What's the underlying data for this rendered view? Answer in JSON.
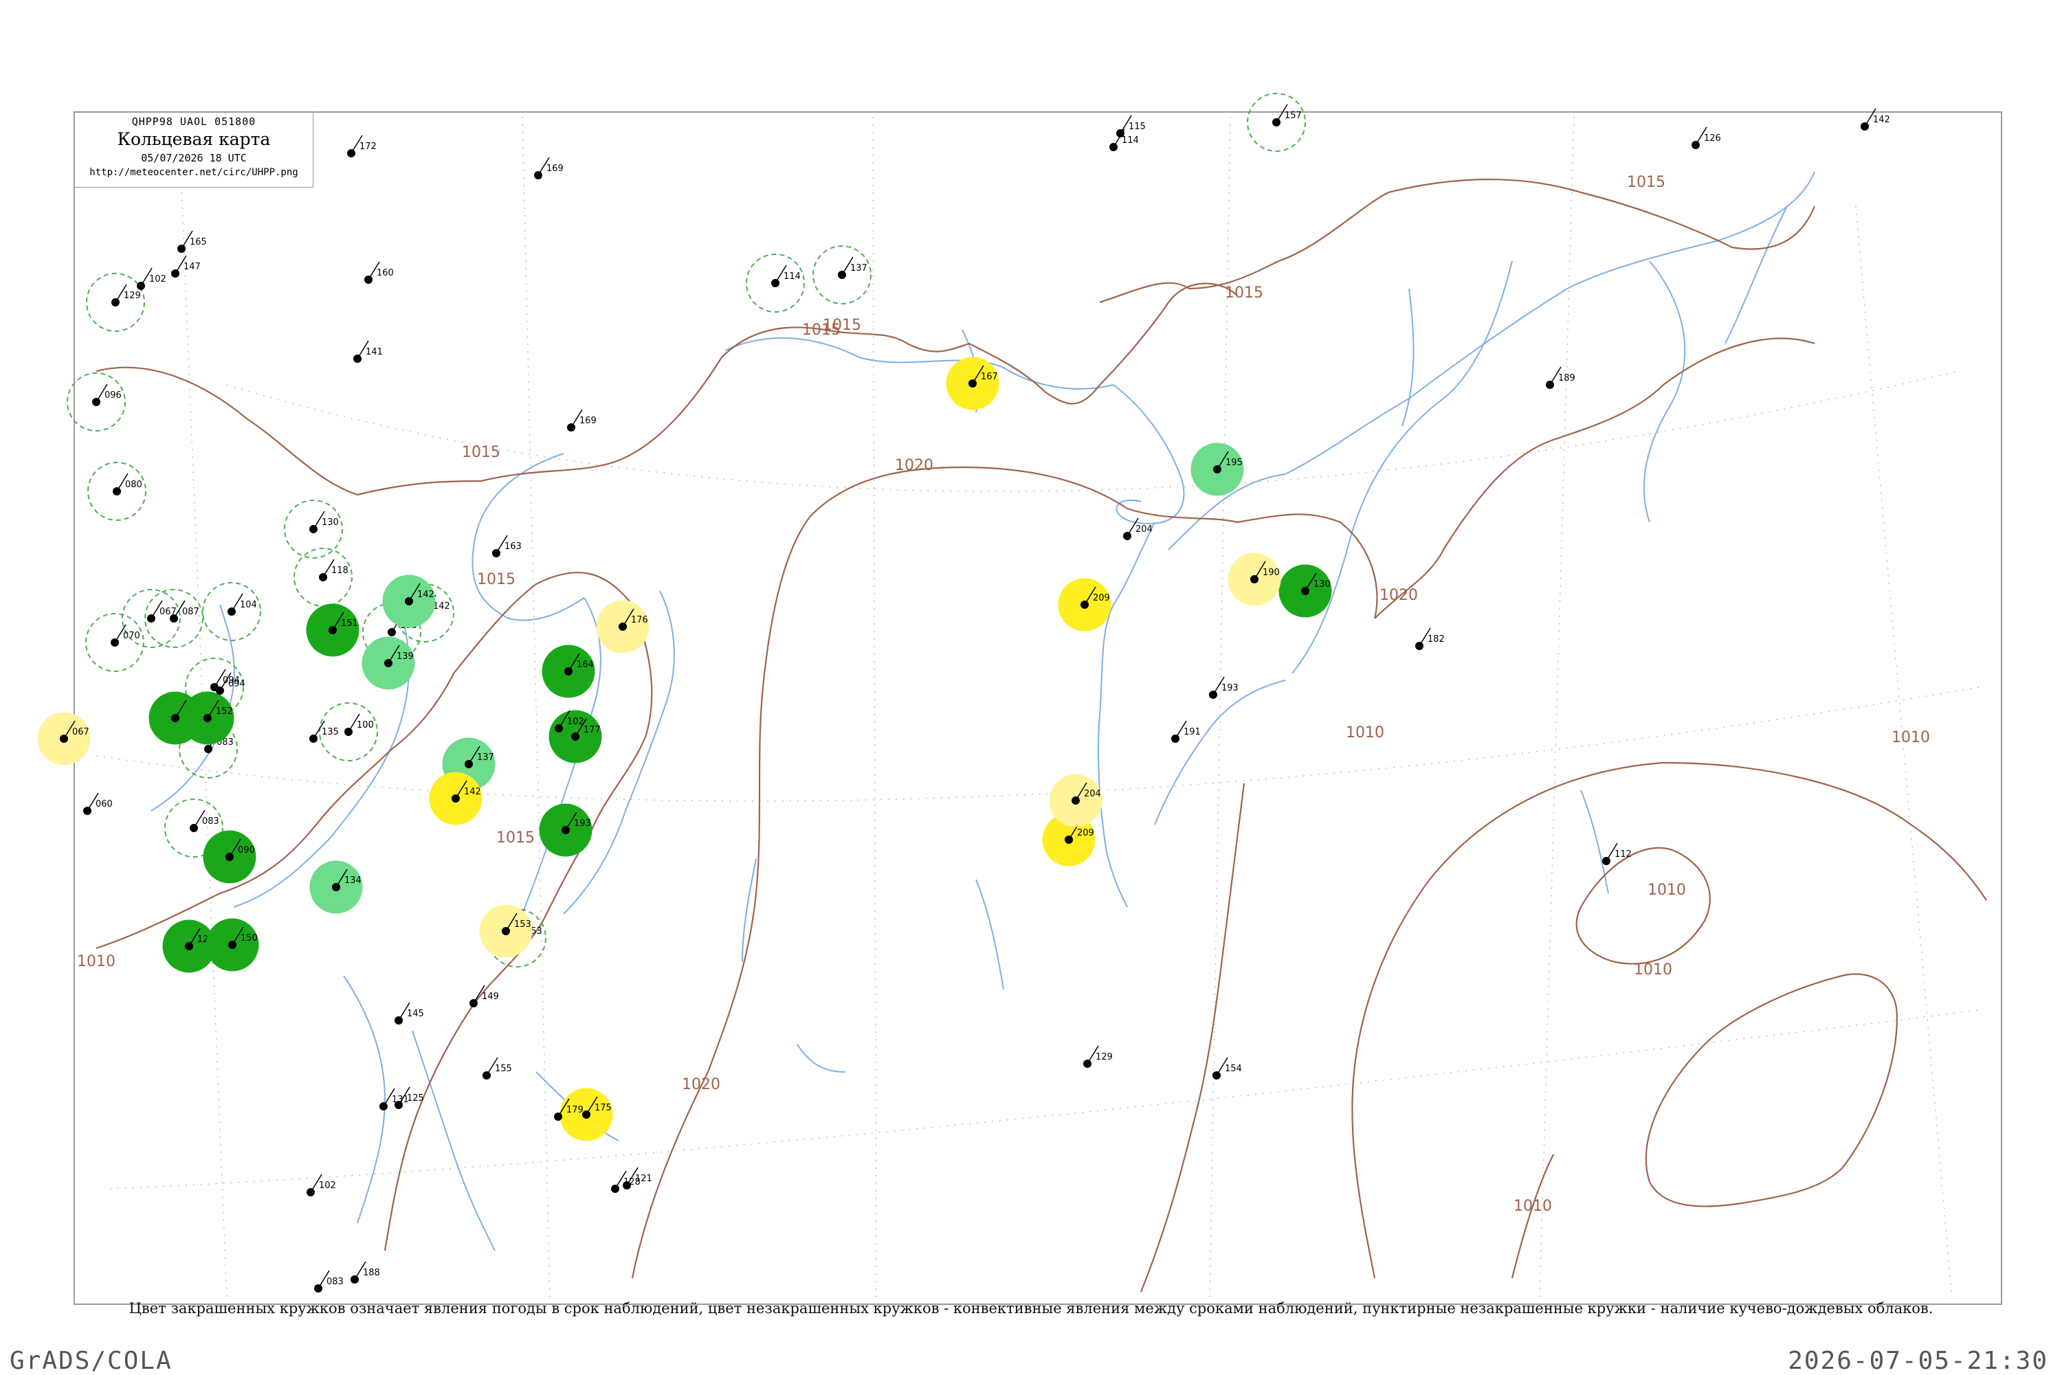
{
  "header": {
    "code": "QHPP98  UAOL  051800",
    "title": "Кольцевая карта",
    "datetime": "05/07/2026 18 UTC",
    "url": "http://meteocenter.net/circ/UHPP.png"
  },
  "caption": "Цвет закрашенных кружков означает явления погоды в срок наблюдений, цвет незакрашенных кружков - конвективные явления между сроками наблюдений, пунктирные незакрашенные кружки - наличие кучево-дождевых облаков.",
  "footer": {
    "left": "GrADS/COLA",
    "right": "2026-07-05-21:30"
  },
  "isobar_labels": [
    "1015",
    "1015",
    "1015",
    "1015",
    "1015",
    "1015",
    "1020",
    "1020",
    "1020",
    "1010",
    "1010",
    "1010",
    "1010",
    "1010",
    "1015",
    "1010"
  ],
  "stations": [
    {
      "p": "ring",
      "c": "#4caf50",
      "num": "129"
    },
    {
      "p": "ring",
      "c": "#4caf50",
      "num": "096"
    },
    {
      "p": "ring",
      "c": "#4caf50",
      "num": "080"
    },
    {
      "p": "ring",
      "c": "#4caf50",
      "num": "130"
    },
    {
      "p": "ring",
      "c": "#4caf50",
      "num": "118"
    },
    {
      "p": "ring",
      "c": "#4caf50",
      "num": "067"
    },
    {
      "p": "ring",
      "c": "#4caf50",
      "num": "070"
    },
    {
      "p": "ring",
      "c": "#4caf50",
      "num": "087"
    },
    {
      "p": "ring",
      "c": "#4caf50",
      "num": "104"
    },
    {
      "p": "ring",
      "c": "#4caf50",
      "num": "094"
    },
    {
      "p": "ring",
      "c": "#4caf50",
      "num": "083"
    },
    {
      "p": "ring",
      "c": "#4caf50",
      "num": "083"
    },
    {
      "p": "ring",
      "c": "#4caf50",
      "num": "100"
    },
    {
      "p": "ring",
      "c": "#4caf50",
      "num": "138"
    },
    {
      "p": "ring",
      "c": "#4caf50",
      "num": "142"
    },
    {
      "p": "ring",
      "c": "#4caf50",
      "num": "114"
    },
    {
      "p": "ring",
      "c": "#4caf50",
      "num": "137"
    },
    {
      "p": "ring",
      "c": "#4caf50",
      "num": "157"
    },
    {
      "p": "ring",
      "c": "#4caf50",
      "num": "153"
    },
    {
      "p": "fill",
      "c": "#1aa81a",
      "num": "140"
    },
    {
      "p": "fill",
      "c": "#1aa81a",
      "num": "152"
    },
    {
      "p": "fill",
      "c": "#1aa81a",
      "num": "090"
    },
    {
      "p": "fill",
      "c": "#1aa81a",
      "num": "128"
    },
    {
      "p": "fill",
      "c": "#1aa81a",
      "num": "150"
    },
    {
      "p": "fill",
      "c": "#1aa81a",
      "num": "151"
    },
    {
      "p": "fill",
      "c": "#1aa81a",
      "num": "164"
    },
    {
      "p": "fill",
      "c": "#1aa81a",
      "num": "177"
    },
    {
      "p": "fill",
      "c": "#1aa81a",
      "num": "193"
    },
    {
      "p": "fill",
      "c": "#1aa81a",
      "num": "130"
    },
    {
      "p": "fill",
      "c": "#6ddc8b",
      "num": "142"
    },
    {
      "p": "fill",
      "c": "#6ddc8b",
      "num": "139"
    },
    {
      "p": "fill",
      "c": "#6ddc8b",
      "num": "137"
    },
    {
      "p": "fill",
      "c": "#6ddc8b",
      "num": "134"
    },
    {
      "p": "fill",
      "c": "#6ddc8b",
      "num": "195"
    },
    {
      "p": "fill",
      "c": "#ffee22",
      "num": "167"
    },
    {
      "p": "fill",
      "c": "#ffee22",
      "num": "209"
    },
    {
      "p": "fill",
      "c": "#ffee22",
      "num": "142"
    },
    {
      "p": "fill",
      "c": "#ffee22",
      "num": "209"
    },
    {
      "p": "fill",
      "c": "#ffee22",
      "num": "175"
    },
    {
      "p": "fill",
      "c": "#fff49a",
      "num": "176"
    },
    {
      "p": "fill",
      "c": "#fff49a",
      "num": "190"
    },
    {
      "p": "fill",
      "c": "#fff49a",
      "num": "204"
    },
    {
      "p": "fill",
      "c": "#fff49a",
      "num": "067"
    },
    {
      "p": "fill",
      "c": "#fff49a",
      "num": "153"
    },
    {
      "p": "plain",
      "c": "#000000",
      "num": "142"
    },
    {
      "p": "plain",
      "c": "#000000",
      "num": "126"
    },
    {
      "p": "plain",
      "c": "#000000",
      "num": "112"
    },
    {
      "p": "plain",
      "c": "#000000",
      "num": "115"
    },
    {
      "p": "plain",
      "c": "#000000",
      "num": "114"
    },
    {
      "p": "plain",
      "c": "#000000",
      "num": "169"
    },
    {
      "p": "plain",
      "c": "#000000",
      "num": "163"
    },
    {
      "p": "plain",
      "c": "#000000",
      "num": "204"
    },
    {
      "p": "plain",
      "c": "#000000",
      "num": "193"
    },
    {
      "p": "plain",
      "c": "#000000",
      "num": "191"
    },
    {
      "p": "plain",
      "c": "#000000",
      "num": "182"
    },
    {
      "p": "plain",
      "c": "#000000",
      "num": "189"
    },
    {
      "p": "plain",
      "c": "#000000",
      "num": "172"
    },
    {
      "p": "plain",
      "c": "#000000",
      "num": "160"
    },
    {
      "p": "plain",
      "c": "#000000",
      "num": "141"
    },
    {
      "p": "plain",
      "c": "#000000",
      "num": "165"
    },
    {
      "p": "plain",
      "c": "#000000",
      "num": "135"
    },
    {
      "p": "plain",
      "c": "#000000",
      "num": "147"
    },
    {
      "p": "plain",
      "c": "#000000",
      "num": "102"
    },
    {
      "p": "plain",
      "c": "#000000",
      "num": "169"
    },
    {
      "p": "plain",
      "c": "#000000",
      "num": "129"
    },
    {
      "p": "plain",
      "c": "#000000",
      "num": "145"
    },
    {
      "p": "plain",
      "c": "#000000",
      "num": "149"
    },
    {
      "p": "plain",
      "c": "#000000",
      "num": "155"
    },
    {
      "p": "plain",
      "c": "#000000",
      "num": "125"
    },
    {
      "p": "plain",
      "c": "#000000",
      "num": "060"
    },
    {
      "p": "plain",
      "c": "#000000",
      "num": "094"
    },
    {
      "p": "plain",
      "c": "#000000",
      "num": "179"
    },
    {
      "p": "plain",
      "c": "#000000",
      "num": "102"
    },
    {
      "p": "plain",
      "c": "#000000",
      "num": "128"
    },
    {
      "p": "plain",
      "c": "#000000",
      "num": "121"
    },
    {
      "p": "plain",
      "c": "#000000",
      "num": "154"
    },
    {
      "p": "plain",
      "c": "#000000",
      "num": "102"
    },
    {
      "p": "plain",
      "c": "#000000",
      "num": "083"
    },
    {
      "p": "plain",
      "c": "#000000",
      "num": "188"
    },
    {
      "p": "plain",
      "c": "#000000",
      "num": "131"
    }
  ]
}
